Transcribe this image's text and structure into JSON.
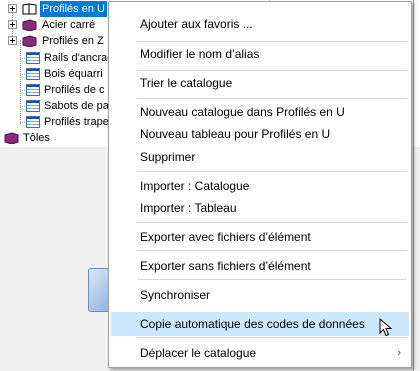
{
  "tree": {
    "items": [
      {
        "label": "Profilés en U",
        "icon": "book-icon",
        "expander": true,
        "selected": true
      },
      {
        "label": "Acier carré",
        "icon": "book-icon",
        "expander": true
      },
      {
        "label": "Profilés en Z",
        "icon": "book-icon",
        "expander": true
      },
      {
        "label": "Rails d'ancrag",
        "icon": "table-icon"
      },
      {
        "label": "Bois équarri",
        "icon": "table-icon"
      },
      {
        "label": "Profilés de c",
        "icon": "table-icon"
      },
      {
        "label": "Sabots de pa",
        "icon": "table-icon"
      },
      {
        "label": "Profilés trape",
        "icon": "table-icon"
      },
      {
        "label": "Tôles",
        "icon": "book-icon"
      }
    ]
  },
  "context_menu": {
    "items": {
      "add_favorites": "Ajouter aux favoris ...",
      "rename_alias": "Modifier le nom d’alias",
      "sort_catalog": "Trier le catalogue",
      "new_catalog": "Nouveau catalogue dans Profilés en U",
      "new_table": "Nouveau tableau pour Profilés en U",
      "delete": "Supprimer",
      "import_catalog": "Importer : Catalogue",
      "import_table": "Importer : Tableau",
      "export_with": "Exporter avec fichiers d’élément",
      "export_without": "Exporter sans fichiers d’élément",
      "synchronize": "Synchroniser",
      "auto_copy": "Copie automatique des codes de données",
      "move_catalog": "Déplacer le catalogue"
    },
    "submenu_arrow": "›",
    "highlight_color": "#cce8ff"
  }
}
